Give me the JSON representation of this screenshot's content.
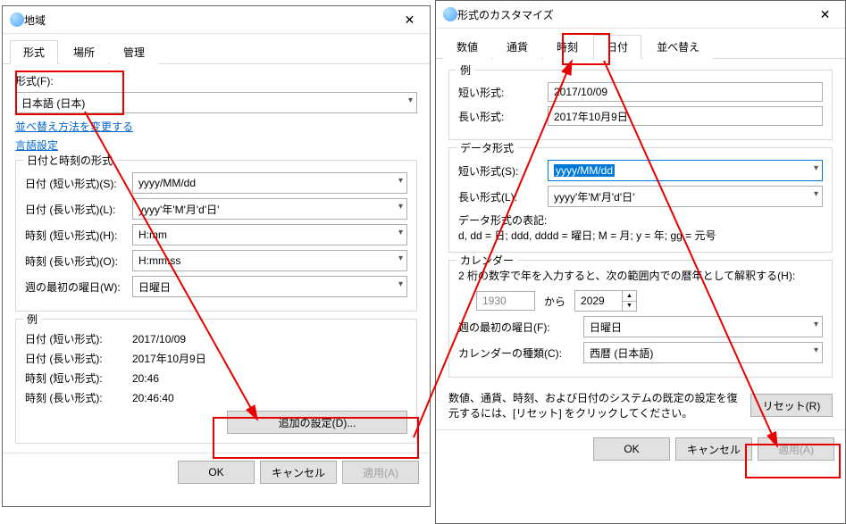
{
  "region": {
    "title": "地域",
    "tabs": {
      "format": "形式",
      "location": "場所",
      "admin": "管理"
    },
    "formatLabel": "形式(F):",
    "formatValue": "日本語 (日本)",
    "sortLink": "並べ替え方法を変更する",
    "langLink": "言語設定",
    "dtGroup": "日付と時刻の形式",
    "shortDateLbl": "日付 (短い形式)(S):",
    "shortDateVal": "yyyy/MM/dd",
    "longDateLbl": "日付 (長い形式)(L):",
    "longDateVal": "yyyy'年'M'月'd'日'",
    "shortTimeLbl": "時刻 (短い形式)(H):",
    "shortTimeVal": "H:mm",
    "longTimeLbl": "時刻 (長い形式)(O):",
    "longTimeVal": "H:mm:ss",
    "firstDayLbl": "週の最初の曜日(W):",
    "firstDayVal": "日曜日",
    "exGroup": "例",
    "exShortDateLbl": "日付 (短い形式):",
    "exShortDateVal": "2017/10/09",
    "exLongDateLbl": "日付 (長い形式):",
    "exLongDateVal": "2017年10月9日",
    "exShortTimeLbl": "時刻 (短い形式):",
    "exShortTimeVal": "20:46",
    "exLongTimeLbl": "時刻 (長い形式):",
    "exLongTimeVal": "20:46:40",
    "additionalBtn": "追加の設定(D)...",
    "ok": "OK",
    "cancel": "キャンセル",
    "apply": "適用(A)"
  },
  "custom": {
    "title": "形式のカスタマイズ",
    "tabs": {
      "number": "数値",
      "currency": "通貨",
      "time": "時刻",
      "date": "日付",
      "sort": "並べ替え"
    },
    "exGroup": "例",
    "shortFmtLbl": "短い形式:",
    "shortFmtVal": "2017/10/09",
    "longFmtLbl": "長い形式:",
    "longFmtVal": "2017年10月9日",
    "dataGroup": "データ形式",
    "shortDataLbl": "短い形式(S):",
    "shortDataVal": "yyyy/MM/dd",
    "longDataLbl": "長い形式(L):",
    "longDataVal": "yyyy'年'M'月'd'日'",
    "notationLbl": "データ形式の表記:",
    "notationTxt": "d, dd = 日;  ddd, dddd = 曜日; M = 月; y = 年; gg = 元号",
    "calGroup": "カレンダー",
    "calTxt": "2 桁の数字で年を入力すると、次の範囲内での暦年として解釈する(H):",
    "yearFrom": "1930",
    "yearFromSuffix": "から",
    "yearTo": "2029",
    "firstDayLbl": "週の最初の曜日(F):",
    "firstDayVal": "日曜日",
    "calTypeLbl": "カレンダーの種類(C):",
    "calTypeVal": "西暦 (日本語)",
    "resetTxt": "数値、通貨、時刻、および日付のシステムの既定の設定を復元するには、[リセット] をクリックしてください。",
    "resetBtn": "リセット(R)",
    "ok": "OK",
    "cancel": "キャンセル",
    "apply": "適用(A)"
  }
}
